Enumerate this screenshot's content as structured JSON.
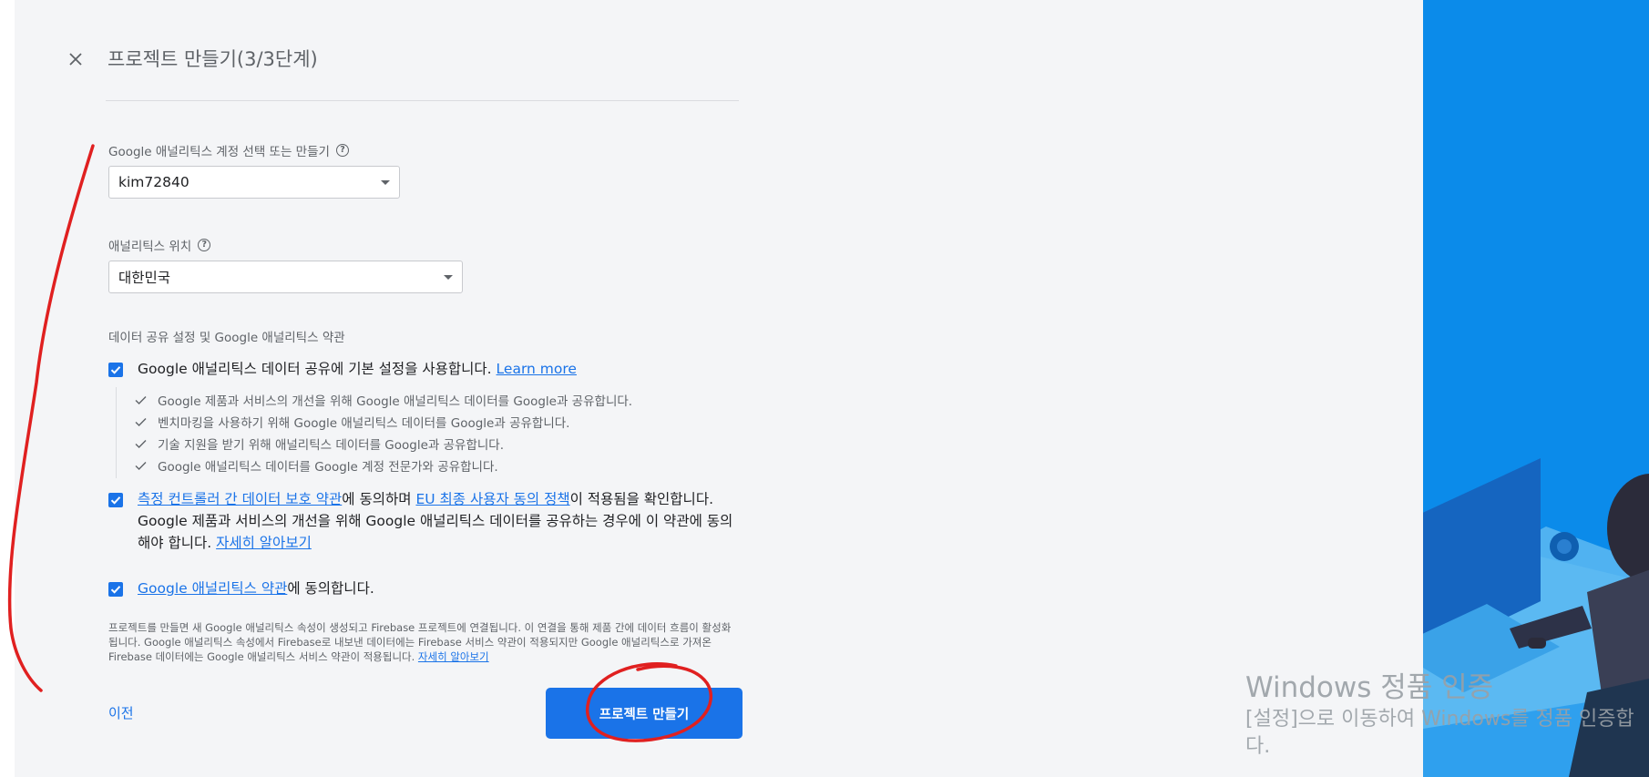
{
  "header": {
    "title": "프로젝트 만들기(3/3단계)",
    "close_icon": "close-icon"
  },
  "analytics_account": {
    "label": "Google 애널리틱스 계정 선택 또는 만들기",
    "value": "kim72840"
  },
  "analytics_location": {
    "label": "애널리틱스 위치",
    "value": "대한민국"
  },
  "data_sharing": {
    "section_label": "데이터 공유 설정 및 Google 애널리틱스 약관",
    "default_checkbox": {
      "text": "Google 애널리틱스 데이터 공유에 기본 설정을 사용합니다.",
      "link": "Learn more",
      "checked": true
    },
    "sub_items": [
      "Google 제품과 서비스의 개선을 위해 Google 애널리틱스 데이터를 Google과 공유합니다.",
      "벤치마킹을 사용하기 위해 Google 애널리틱스 데이터를 Google과 공유합니다.",
      "기술 지원을 받기 위해 애널리틱스 데이터를 Google과 공유합니다.",
      "Google 애널리틱스 데이터를 Google 계정 전문가와 공유합니다."
    ],
    "controller_terms": {
      "link1": "측정 컨트롤러 간 데이터 보호 약관",
      "text1": "에 동의하며 ",
      "link2": "EU 최종 사용자 동의 정책",
      "text2": "이 적용됨을 확인합니다. Google 제품과 서비스의 개선을 위해 Google 애널리틱스 데이터를 공유하는 경우에 이 약관에 동의해야 합니다. ",
      "link3": "자세히 알아보기",
      "checked": true
    },
    "analytics_terms": {
      "link": "Google 애널리틱스 약관",
      "text": "에 동의합니다.",
      "checked": true
    }
  },
  "disclaimer": {
    "text": "프로젝트를 만들면 새 Google 애널리틱스 속성이 생성되고 Firebase 프로젝트에 연결됩니다. 이 연결을 통해 제품 간에 데이터 흐름이 활성화됩니다. Google 애널리틱스 속성에서 Firebase로 내보낸 데이터에는 Firebase 서비스 약관이 적용되지만 Google 애널리틱스로 가져온 Firebase 데이터에는 Google 애널리틱스 서비스 약관이 적용됩니다. ",
    "link": "자세히 알아보기"
  },
  "footer": {
    "prev_label": "이전",
    "create_label": "프로젝트 만들기"
  },
  "watermark": {
    "title": "Windows 정품 인증",
    "line1": "[설정]으로 이동하여 Windows를 정품 인증합",
    "line2": "다."
  },
  "colors": {
    "accent": "#1a73e8",
    "hero": "#0b8bea",
    "annotation": "#e02020"
  }
}
